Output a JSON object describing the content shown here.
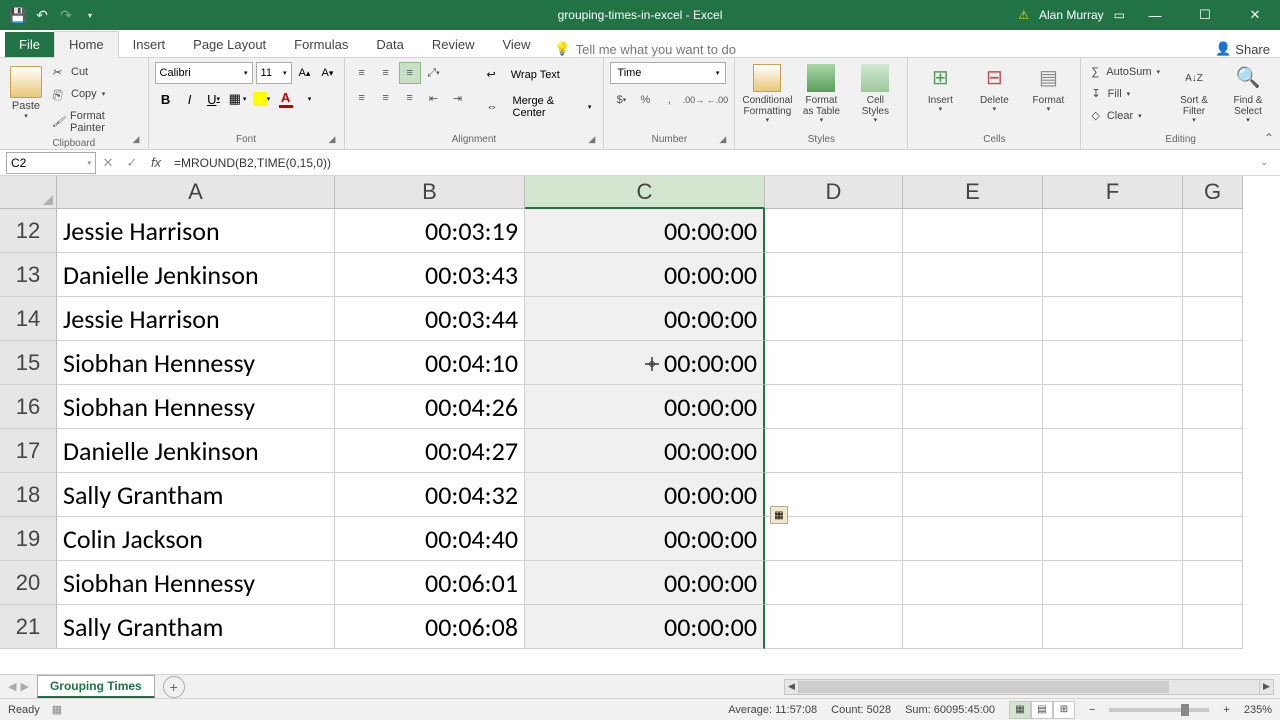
{
  "title_bar": {
    "document_name": "grouping-times-in-excel - Excel",
    "user_name": "Alan Murray"
  },
  "ribbon_tabs": {
    "file": "File",
    "tabs": [
      "Home",
      "Insert",
      "Page Layout",
      "Formulas",
      "Data",
      "Review",
      "View"
    ],
    "active": "Home",
    "tell_me": "Tell me what you want to do",
    "share": "Share"
  },
  "ribbon": {
    "clipboard": {
      "title": "Clipboard",
      "paste": "Paste",
      "cut": "Cut",
      "copy": "Copy",
      "format_painter": "Format Painter"
    },
    "font": {
      "title": "Font",
      "font_name": "Calibri",
      "font_size": "11"
    },
    "alignment": {
      "title": "Alignment",
      "wrap": "Wrap Text",
      "merge": "Merge & Center"
    },
    "number": {
      "title": "Number",
      "format": "Time"
    },
    "styles": {
      "title": "Styles",
      "conditional": "Conditional Formatting",
      "format_table": "Format as Table",
      "cell_styles": "Cell Styles"
    },
    "cells": {
      "title": "Cells",
      "insert": "Insert",
      "delete": "Delete",
      "format": "Format"
    },
    "editing": {
      "title": "Editing",
      "autosum": "AutoSum",
      "fill": "Fill",
      "clear": "Clear",
      "sort": "Sort & Filter",
      "find": "Find & Select"
    }
  },
  "formula_bar": {
    "name_box": "C2",
    "formula": "=MROUND(B2,TIME(0,15,0))"
  },
  "grid": {
    "columns": [
      "A",
      "B",
      "C",
      "D",
      "E",
      "F",
      "G"
    ],
    "selected_column": "C",
    "row_start": 12,
    "rows": [
      {
        "n": 12,
        "a": "Jessie Harrison",
        "b": "00:03:19",
        "c": "00:00:00"
      },
      {
        "n": 13,
        "a": "Danielle Jenkinson",
        "b": "00:03:43",
        "c": "00:00:00"
      },
      {
        "n": 14,
        "a": "Jessie Harrison",
        "b": "00:03:44",
        "c": "00:00:00"
      },
      {
        "n": 15,
        "a": "Siobhan Hennessy",
        "b": "00:04:10",
        "c": "00:00:00"
      },
      {
        "n": 16,
        "a": "Siobhan Hennessy",
        "b": "00:04:26",
        "c": "00:00:00"
      },
      {
        "n": 17,
        "a": "Danielle Jenkinson",
        "b": "00:04:27",
        "c": "00:00:00"
      },
      {
        "n": 18,
        "a": "Sally Grantham",
        "b": "00:04:32",
        "c": "00:00:00"
      },
      {
        "n": 19,
        "a": "Colin Jackson",
        "b": "00:04:40",
        "c": "00:00:00"
      },
      {
        "n": 20,
        "a": "Siobhan Hennessy",
        "b": "00:06:01",
        "c": "00:00:00"
      },
      {
        "n": 21,
        "a": "Sally Grantham",
        "b": "00:06:08",
        "c": "00:00:00"
      }
    ]
  },
  "sheet_tabs": {
    "active": "Grouping Times"
  },
  "status_bar": {
    "mode": "Ready",
    "average": "Average: 11:57:08",
    "count": "Count: 5028",
    "sum": "Sum: 60095:45:00",
    "zoom": "235%"
  }
}
